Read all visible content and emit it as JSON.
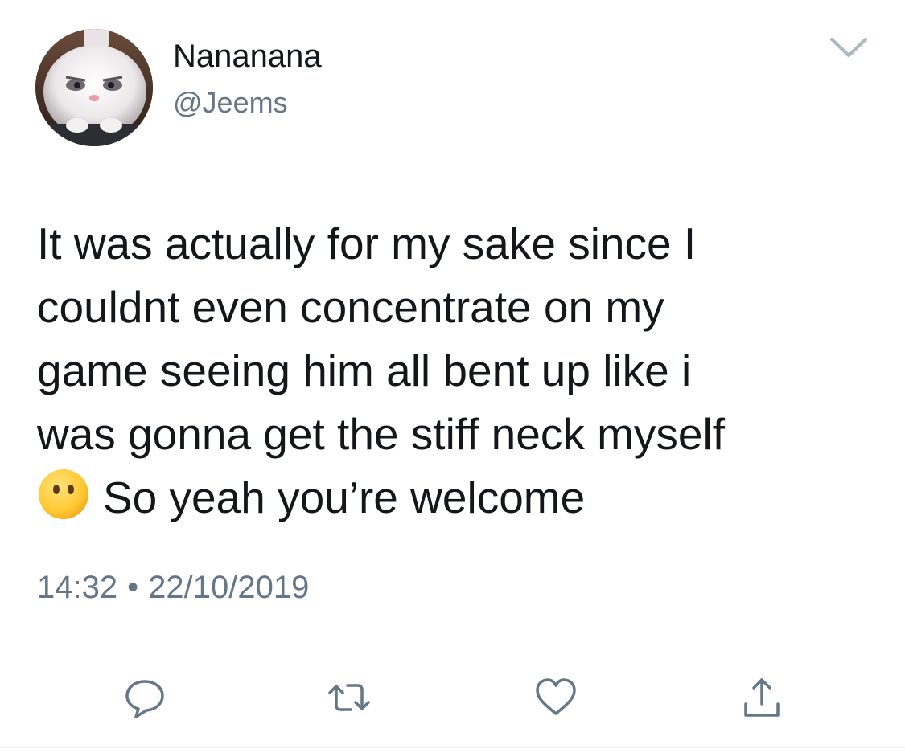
{
  "tweet": {
    "author": {
      "display_name": "Nananana",
      "handle": "@Jeems",
      "avatar": "white-rabbit-avatar"
    },
    "text_lines": [
      "It was actually for my sake since I",
      "couldnt even concentrate on my",
      "game seeing him all bent up like i",
      "was gonna get the stiff neck myself",
      "So yeah you’re welcome"
    ],
    "emoji": "face-without-mouth",
    "time": "14:32",
    "separator": "•",
    "date": "22/10/2019"
  },
  "actions": {
    "reply": "reply-icon",
    "retweet": "retweet-icon",
    "like": "heart-icon",
    "share": "share-icon"
  },
  "menu": {
    "icon": "chevron-down-icon"
  },
  "colors": {
    "text": "#14171a",
    "secondary": "#657786",
    "divider": "#d8dde2"
  }
}
